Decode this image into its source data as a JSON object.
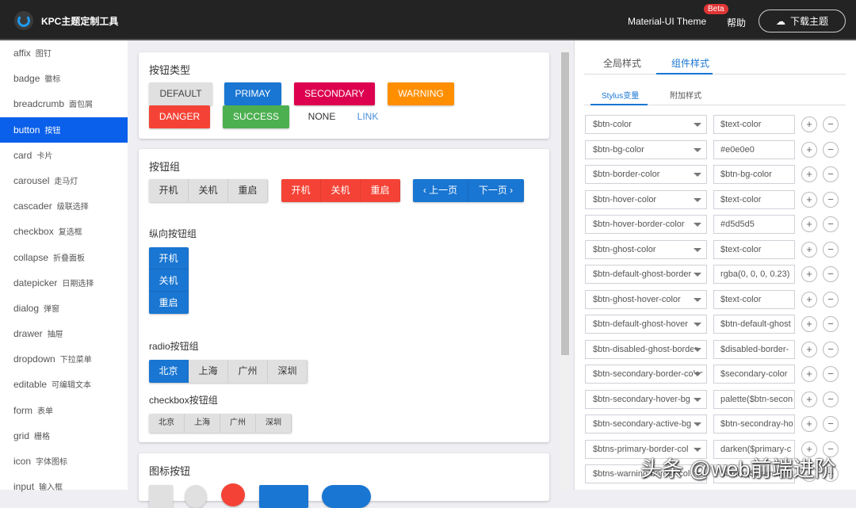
{
  "header": {
    "title": "KPC主题定制工具",
    "theme": "Material-UI Theme",
    "beta": "Beta",
    "help": "帮助",
    "download": "下载主题"
  },
  "sidebar": [
    {
      "en": "affix",
      "zh": "图钉"
    },
    {
      "en": "badge",
      "zh": "徽标"
    },
    {
      "en": "breadcrumb",
      "zh": "面包屑"
    },
    {
      "en": "button",
      "zh": "按钮"
    },
    {
      "en": "card",
      "zh": "卡片"
    },
    {
      "en": "carousel",
      "zh": "走马灯"
    },
    {
      "en": "cascader",
      "zh": "级联选择"
    },
    {
      "en": "checkbox",
      "zh": "复选框"
    },
    {
      "en": "collapse",
      "zh": "折叠面板"
    },
    {
      "en": "datepicker",
      "zh": "日期选择"
    },
    {
      "en": "dialog",
      "zh": "弹窗"
    },
    {
      "en": "drawer",
      "zh": "抽屉"
    },
    {
      "en": "dropdown",
      "zh": "下拉菜单"
    },
    {
      "en": "editable",
      "zh": "可编辑文本"
    },
    {
      "en": "form",
      "zh": "表单"
    },
    {
      "en": "grid",
      "zh": "栅格"
    },
    {
      "en": "icon",
      "zh": "字体图标"
    },
    {
      "en": "input",
      "zh": "输入框"
    }
  ],
  "types": {
    "title": "按钮类型",
    "buttons": [
      "DEFAULT",
      "PRIMAY",
      "SECONDARY",
      "WARNING",
      "DANGER",
      "SUCCESS",
      "NONE",
      "LINK"
    ]
  },
  "groups": {
    "title": "按钮组",
    "g1": [
      "开机",
      "关机",
      "重启"
    ],
    "prev": "‹ 上一页",
    "next": "下一页 ›",
    "vertical_label": "纵向按钮组",
    "radio_label": "radio按钮组",
    "checkbox_label": "checkbox按钮组",
    "cities": [
      "北京",
      "上海",
      "广州",
      "深圳"
    ]
  },
  "icons": {
    "title": "图标按钮"
  },
  "right": {
    "tabs": [
      "全局样式",
      "组件样式"
    ],
    "subtabs": [
      "Stylus变量",
      "附加样式"
    ],
    "rows": [
      [
        "$btn-color",
        "$text-color"
      ],
      [
        "$btn-bg-color",
        "#e0e0e0"
      ],
      [
        "$btn-border-color",
        "$btn-bg-color"
      ],
      [
        "$btn-hover-color",
        "$text-color"
      ],
      [
        "$btn-hover-border-color",
        "#d5d5d5"
      ],
      [
        "$btn-ghost-color",
        "$text-color"
      ],
      [
        "$btn-default-ghost-border",
        "rgba(0, 0, 0, 0.23)"
      ],
      [
        "$btn-ghost-hover-color",
        "$text-color"
      ],
      [
        "$btn-default-ghost-hover",
        "$btn-default-ghost"
      ],
      [
        "$btn-disabled-ghost-border",
        "$disabled-border-"
      ],
      [
        "$btn-secondary-border-color",
        "$secondary-color"
      ],
      [
        "$btn-secondary-hover-bg",
        "palette($btn-secon"
      ],
      [
        "$btn-secondary-active-bg",
        "$btn-secondray-ho"
      ],
      [
        "$btns-primary-border-col",
        "darken($primary-c"
      ],
      [
        "$btns-warning-border-col",
        "darken($warning-"
      ]
    ],
    "plus": "+",
    "minus": "−"
  },
  "watermark": "头条 @web前端进阶"
}
